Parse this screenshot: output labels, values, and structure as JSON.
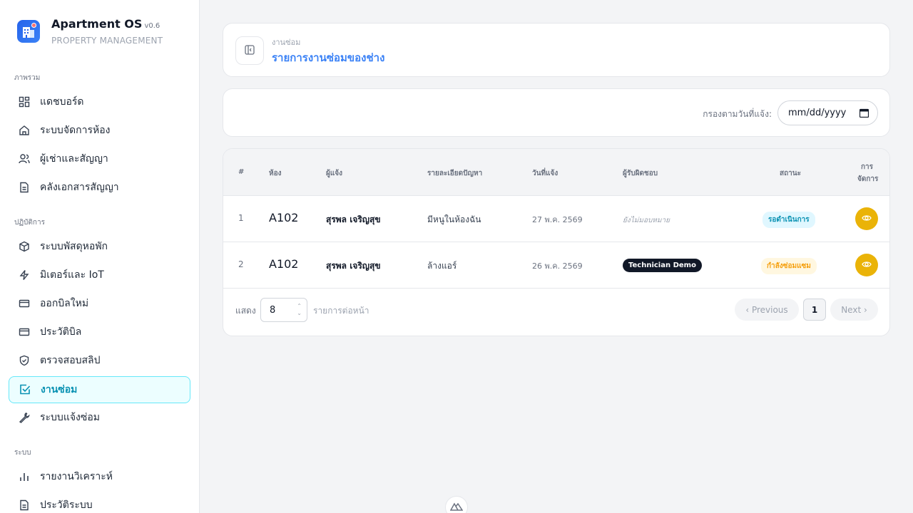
{
  "app": {
    "title": "Apartment OS",
    "version": "v0.6",
    "subtitle": "PROPERTY MANAGEMENT"
  },
  "sidebar": {
    "sections": [
      {
        "label": "ภาพรวม",
        "items": [
          {
            "label": "แดชบอร์ด",
            "icon": "grid-icon"
          },
          {
            "label": "ระบบจัดการห้อง",
            "icon": "home-icon"
          },
          {
            "label": "ผู้เช่าและสัญญา",
            "icon": "users-icon"
          },
          {
            "label": "คลังเอกสารสัญญา",
            "icon": "document-icon"
          }
        ]
      },
      {
        "label": "ปฏิบัติการ",
        "items": [
          {
            "label": "ระบบพัสดุหอพัก",
            "icon": "package-icon"
          },
          {
            "label": "มิเตอร์และ IoT",
            "icon": "bolt-icon"
          },
          {
            "label": "ออกบิลใหม่",
            "icon": "card-icon"
          },
          {
            "label": "ประวัติบิล",
            "icon": "card-icon"
          },
          {
            "label": "ตรวจสอบสลิป",
            "icon": "shield-icon"
          },
          {
            "label": "งานซ่อม",
            "icon": "checkbox-icon",
            "active": true
          },
          {
            "label": "ระบบแจ้งซ่อม",
            "icon": "wrench-icon"
          }
        ]
      },
      {
        "label": "ระบบ",
        "items": [
          {
            "label": "รายงานวิเคราะห์",
            "icon": "bar-chart-icon"
          },
          {
            "label": "ประวัติระบบ",
            "icon": "document-icon"
          }
        ]
      }
    ]
  },
  "header": {
    "breadcrumb": "งานซ่อม",
    "title": "รายการงานซ่อมของช่าง"
  },
  "filter": {
    "label": "กรองตามวันที่แจ้ง:",
    "date_placeholder": "mm/dd/yyyy"
  },
  "table": {
    "columns": [
      "#",
      "ห้อง",
      "ผู้แจ้ง",
      "รายละเอียดปัญหา",
      "วันที่แจ้ง",
      "ผู้รับผิดชอบ",
      "สถานะ",
      "การ",
      "จัดการ"
    ],
    "rows": [
      {
        "num": "1",
        "room": "A102",
        "reporter": "สุรพล เจริญสุข",
        "detail": "มีหนูในห้องฉัน",
        "date": "27 พ.ค. 2569",
        "assignee": "ยังไม่มอบหมาย",
        "assigned": false,
        "status": "รอดำเนินการ",
        "status_color": "#0891b2"
      },
      {
        "num": "2",
        "room": "A102",
        "reporter": "สุรพล เจริญสุข",
        "detail": "ล้างแอร์",
        "date": "26 พ.ค. 2569",
        "assignee": "Technician Demo",
        "assigned": true,
        "status": "กำลังซ่อมแซม",
        "status_color": "#f59e0b"
      }
    ]
  },
  "pagination": {
    "show_label": "แสดง",
    "page_size": "8",
    "per_page_label": "รายการต่อหน้า",
    "prev": "‹ Previous",
    "current": "1",
    "next": "Next ›"
  },
  "colors": {
    "accent": "#3b82f6",
    "active": "#0891b2",
    "view_button": "#eab308"
  }
}
